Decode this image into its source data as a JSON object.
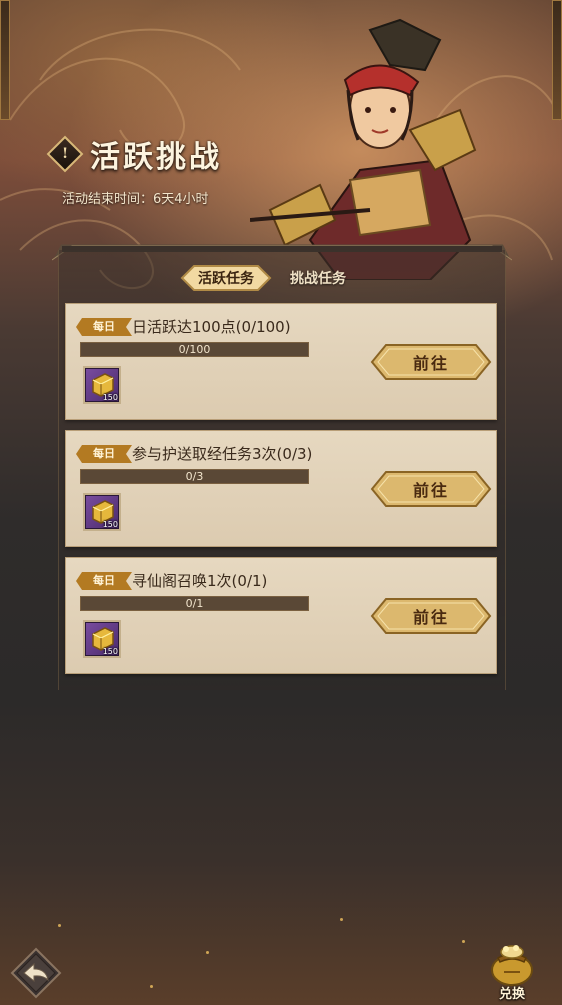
{
  "header": {
    "title_icon_char": "!",
    "title": "活跃挑战",
    "end_time_text": "活动结束时间：6天4小时"
  },
  "tabs": [
    {
      "label": "活跃任务",
      "active": true
    },
    {
      "label": "挑战任务",
      "active": false
    }
  ],
  "tasks": [
    {
      "badge": "每日",
      "title": "日活跃达100点(0/100)",
      "progress_text": "0/100",
      "progress": 0,
      "reward_icon": "gold-ingot-icon",
      "reward_count": "150",
      "button": "前往"
    },
    {
      "badge": "每日",
      "title": "参与护送取经任务3次(0/3)",
      "progress_text": "0/3",
      "progress": 0,
      "reward_icon": "gold-ingot-icon",
      "reward_count": "150",
      "button": "前往"
    },
    {
      "badge": "每日",
      "title": "寻仙阁召唤1次(0/1)",
      "progress_text": "0/1",
      "progress": 0,
      "reward_icon": "gold-ingot-icon",
      "reward_count": "150",
      "button": "前往"
    }
  ],
  "footer": {
    "back_icon": "back-arrow-icon",
    "exchange_icon": "treasure-pot-icon",
    "exchange_label": "兑换"
  },
  "colors": {
    "card_bg": "#e6d8c0",
    "badge": "#b37a22",
    "button_gold": "#d9b46a",
    "progress_track": "#5a4836",
    "reward_frame": "#6a3f92"
  }
}
